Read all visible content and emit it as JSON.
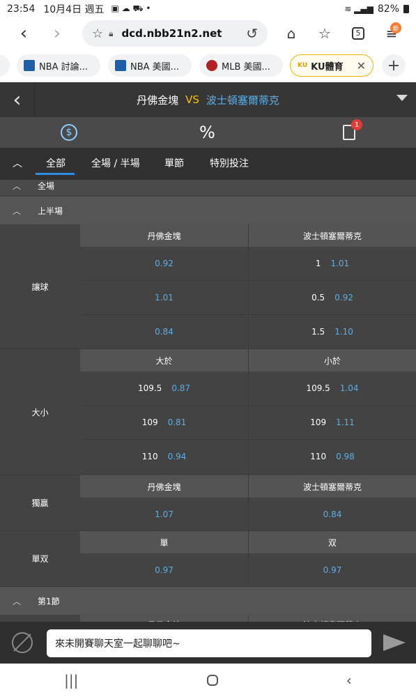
{
  "status": {
    "time": "23:54",
    "date": "10月4日 週五",
    "battery": "82%"
  },
  "browser": {
    "url": "dcd.nbb21n2.net",
    "tabs": [
      {
        "label": "NBA 討論...",
        "icon": "nba-site-icon"
      },
      {
        "label": "NBA 美國...",
        "icon": "nba-site-icon"
      },
      {
        "label": "MLB 美國...",
        "icon": "mlb-site-icon"
      },
      {
        "label": "KU體育",
        "icon": "ku-icon"
      }
    ],
    "menu_badge": "新",
    "tab_count": "5"
  },
  "match": {
    "home": "丹佛金塊",
    "vs": "VS",
    "away": "波士頓塞爾蒂克"
  },
  "icon_row": {
    "percent": "%",
    "bet_badge": "1"
  },
  "filters": [
    "全部",
    "全場 / 半場",
    "單節",
    "特別投注"
  ],
  "sections": {
    "full": "全場",
    "first_half": "上半場",
    "q1": "第1節"
  },
  "markets": {
    "handicap": {
      "label": "讓球",
      "home_head": "丹佛金塊",
      "away_head": "波士頓塞爾蒂克",
      "rows": [
        {
          "home_line": "",
          "home_odds": "0.92",
          "away_line": "1",
          "away_odds": "1.01"
        },
        {
          "home_line": "",
          "home_odds": "1.01",
          "away_line": "0.5",
          "away_odds": "0.92"
        },
        {
          "home_line": "",
          "home_odds": "0.84",
          "away_line": "1.5",
          "away_odds": "1.10"
        }
      ]
    },
    "total": {
      "label": "大小",
      "home_head": "大於",
      "away_head": "小於",
      "rows": [
        {
          "home_line": "109.5",
          "home_odds": "0.87",
          "away_line": "109.5",
          "away_odds": "1.04"
        },
        {
          "home_line": "109",
          "home_odds": "0.81",
          "away_line": "109",
          "away_odds": "1.11"
        },
        {
          "home_line": "110",
          "home_odds": "0.94",
          "away_line": "110",
          "away_odds": "0.98"
        }
      ]
    },
    "moneyline": {
      "label": "獨贏",
      "home_head": "丹佛金塊",
      "away_head": "波士頓塞爾蒂克",
      "home_odds": "1.07",
      "away_odds": "0.84"
    },
    "oddeven": {
      "label": "單双",
      "home_head": "單",
      "away_head": "双",
      "home_odds": "0.97",
      "away_odds": "0.97"
    },
    "q1_peek": {
      "home_head": "丹佛金塊",
      "away_head": "波士頓塞爾蒂克"
    }
  },
  "chat": {
    "placeholder": "來未開賽聊天室一起聊聊吧~"
  },
  "colors": {
    "odds": "#5aaee8",
    "vs": "#f5c400",
    "away": "#5aaee8",
    "active_tab_underline": "#2f8fe0",
    "badge": "#e53935"
  }
}
